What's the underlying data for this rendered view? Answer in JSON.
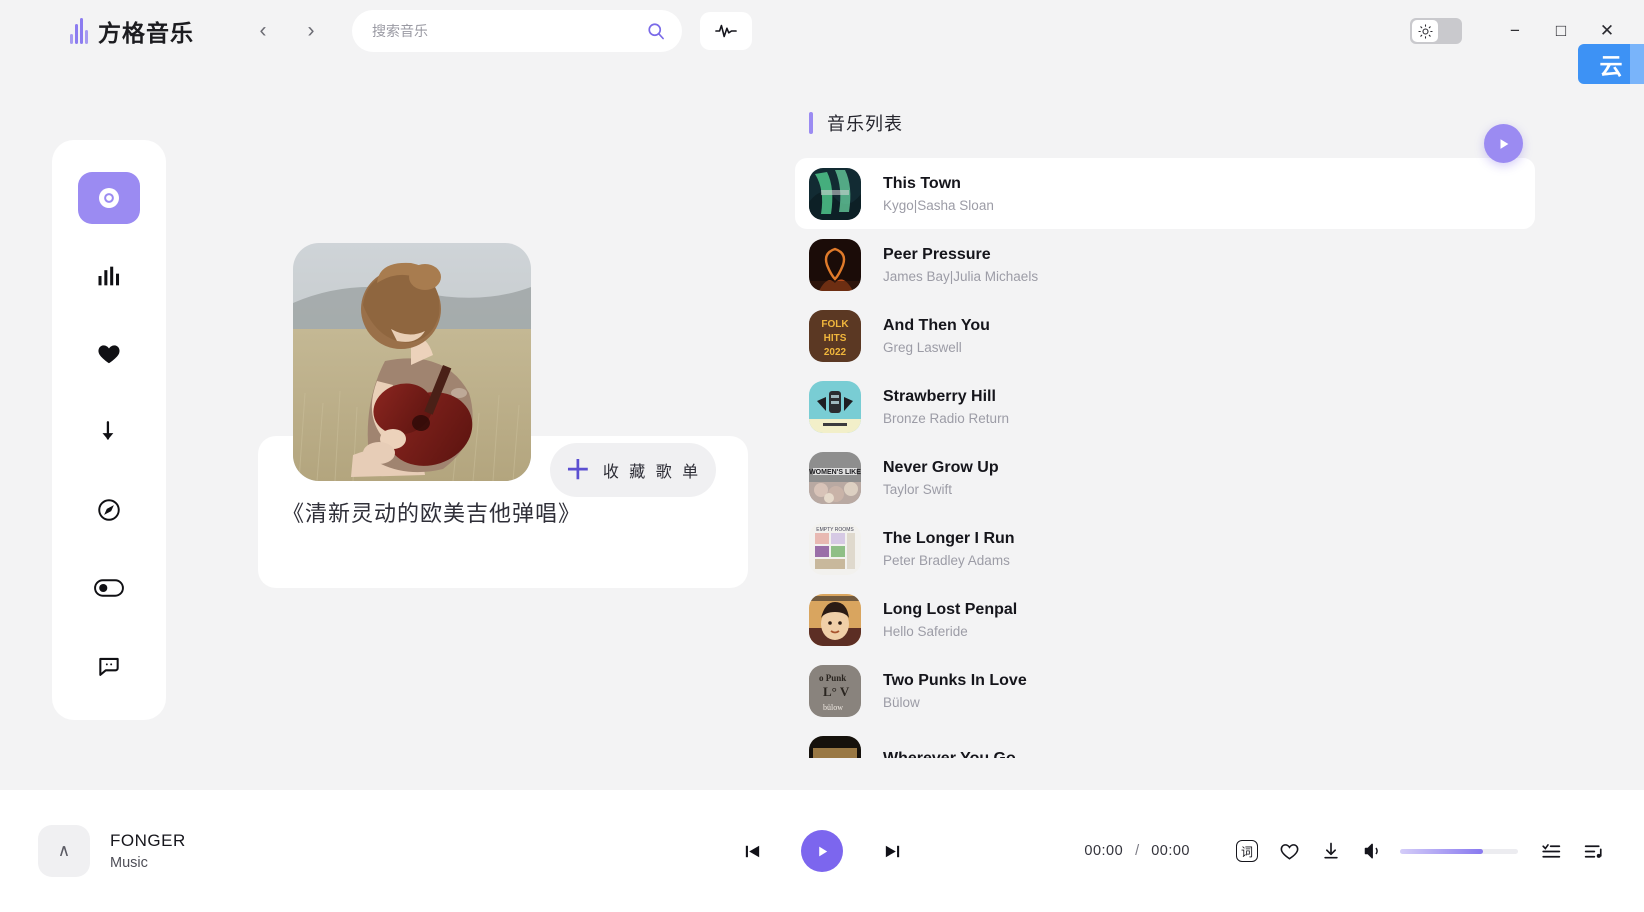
{
  "app": {
    "logo_text": "方格音乐",
    "accent": "#8c7cf0",
    "play_accent": "#7c66ee"
  },
  "titlebar": {
    "back_icon": "‹",
    "forward_icon": "›",
    "search_placeholder": "搜索音乐",
    "search_value": "",
    "minimize": "−",
    "maximize": "□",
    "close": "✕",
    "ime_char": "云"
  },
  "sidebar": {
    "items": [
      {
        "name": "disc",
        "label": "发现音乐"
      },
      {
        "name": "chart",
        "label": "排行榜"
      },
      {
        "name": "heart",
        "label": "我的收藏"
      },
      {
        "name": "download",
        "label": "下载管理"
      },
      {
        "name": "compass",
        "label": "探索"
      },
      {
        "name": "toggle",
        "label": "设置开关"
      },
      {
        "name": "comment",
        "label": "反馈"
      }
    ]
  },
  "hero": {
    "album_title": "《清新灵动的欧美吉他弹唱》",
    "favorite_label": "收 藏 歌 单",
    "favorite_plus": "＋"
  },
  "playlist": {
    "title": "音乐列表",
    "tracks": [
      {
        "title": "This Town",
        "artist": "Kygo|Sasha Sloan",
        "active": true
      },
      {
        "title": "Peer Pressure",
        "artist": "James Bay|Julia Michaels",
        "active": false
      },
      {
        "title": "And Then You",
        "artist": "Greg Laswell",
        "active": false
      },
      {
        "title": "Strawberry Hill",
        "artist": "Bronze Radio Return",
        "active": false
      },
      {
        "title": "Never Grow Up",
        "artist": "Taylor Swift",
        "active": false
      },
      {
        "title": "The Longer I Run",
        "artist": "Peter Bradley Adams",
        "active": false
      },
      {
        "title": "Long Lost Penpal",
        "artist": "Hello Saferide",
        "active": false
      },
      {
        "title": "Two Punks In Love",
        "artist": "Bülow",
        "active": false
      },
      {
        "title": "Wherever You Go",
        "artist": "",
        "active": false
      }
    ]
  },
  "player": {
    "now_playing_title": "FONGER",
    "now_playing_sub": "Music",
    "expand_icon": "∧",
    "current_time": "00:00",
    "time_separator": "/",
    "total_time": "00:00",
    "volume_percent": 70
  }
}
